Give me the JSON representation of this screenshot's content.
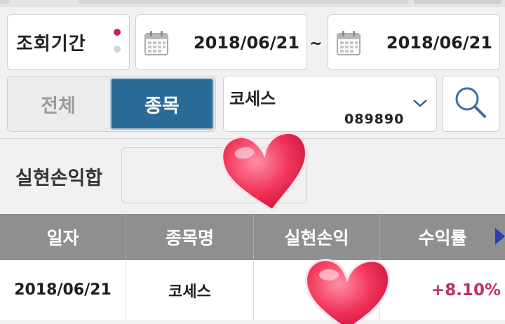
{
  "filter": {
    "period_label": "조회기간",
    "start_date": "2018/06/21",
    "separator": "~",
    "end_date": "2018/06/21"
  },
  "scope_tabs": {
    "all": "전체",
    "stock": "종목",
    "selected": "stock"
  },
  "stock": {
    "name": "코세스",
    "code": "089890"
  },
  "summary": {
    "label": "실현손익합",
    "value": ""
  },
  "table": {
    "headers": [
      "일자",
      "종목명",
      "실현손익",
      "수익률"
    ],
    "rows": [
      {
        "date": "2018/06/21",
        "name": "코세스",
        "pnl": "",
        "return": "+8.10%"
      }
    ]
  },
  "colors": {
    "accent": "#2b6b98",
    "positive": "#c22e6a",
    "header_bg": "#8f8f8f"
  },
  "icons": [
    "calendar-icon",
    "chevron-down-icon",
    "search-icon",
    "scroll-right-arrow-icon",
    "heart-sticker"
  ]
}
